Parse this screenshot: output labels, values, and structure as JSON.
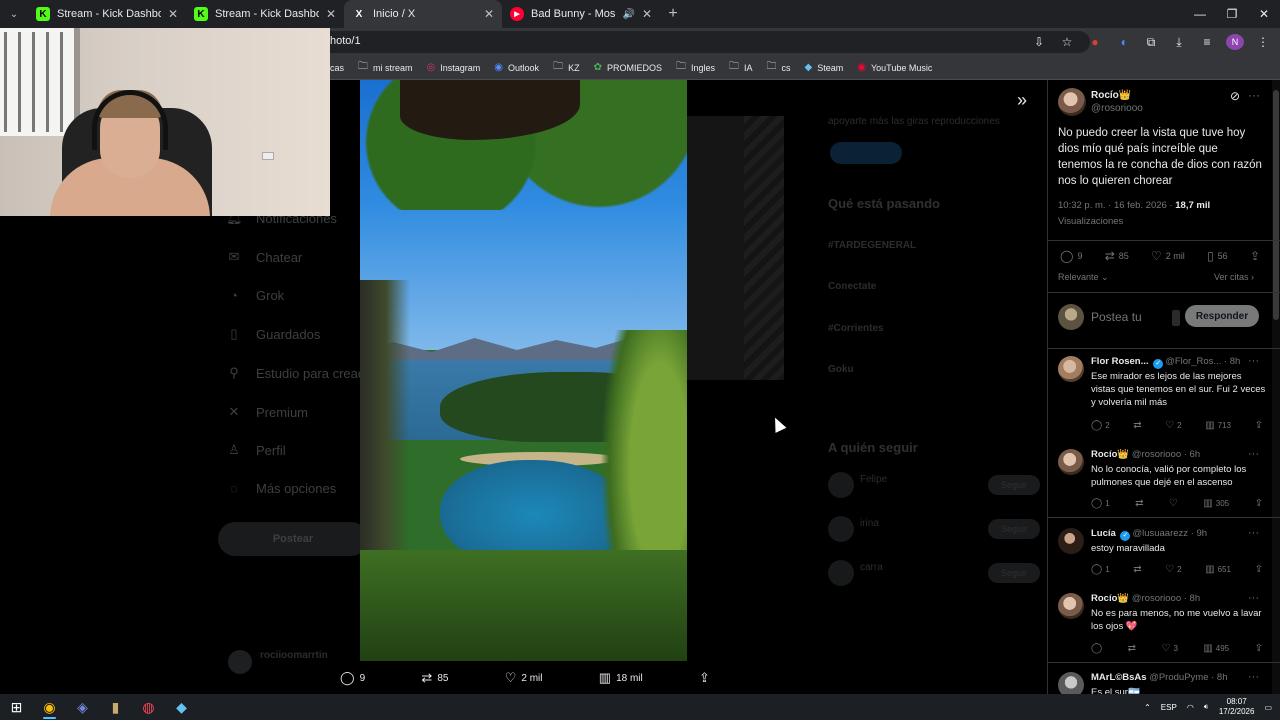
{
  "browser": {
    "tabs": [
      {
        "title": "Stream - Kick Dashboard",
        "favicon": "K",
        "color": "#53fc18"
      },
      {
        "title": "Stream - Kick Dashboard",
        "favicon": "K",
        "color": "#53fc18"
      },
      {
        "title": "Inicio / X",
        "favicon": "X",
        "color": "#ffffff"
      },
      {
        "title": "Bad Bunny - Moscow Mule",
        "favicon": "▶",
        "color": "#ff0033"
      }
    ],
    "url": "hoto/1",
    "bookmarks": [
      "cas",
      "mi stream",
      "Instagram",
      "Outlook",
      "KZ",
      "PROMIEDOS",
      "Ingles",
      "IA",
      "cs",
      "Steam",
      "YouTube Music"
    ],
    "profile_initial": "N"
  },
  "dimmed_nav": [
    "Notificaciones",
    "Chatear",
    "Grok",
    "Guardados",
    "Estudio para creadores",
    "Premium",
    "Perfil",
    "Más opciones"
  ],
  "dimmed_post_button": "Postear",
  "dimmed_user": "rociioomarrtin",
  "dimmed_right": {
    "premium_text": "apoyarte más las giras reproducciones",
    "trending_title": "Qué está pasando",
    "trends": [
      "#TARDEGENERAL",
      "Conectate",
      "#Corrientes",
      "Goku"
    ],
    "follow_title": "A quién seguir",
    "follow_names": [
      "Felipe",
      "irina",
      "carra"
    ],
    "follow_label": "Seguir"
  },
  "photo_bar": {
    "replies": "9",
    "reposts": "85",
    "likes": "2 mil",
    "views": "18 mil"
  },
  "post": {
    "author": "Rocío👑",
    "handle": "@rosoriooo",
    "text": "No puedo creer la vista que tuve hoy dios mío qué país increíble que tenemos la re concha de dios con razón nos lo quieren chorear",
    "time": "10:32 p. m. · 16 feb. 2026 · ",
    "views": "18,7 mil",
    "views_label": "Visualizaciones",
    "replies": "9",
    "reposts": "85",
    "likes": "2 mil",
    "bookmarks": "56",
    "sort_label": "Relevante",
    "see_quotes": "Ver citas",
    "reply_placeholder": "Postea tu",
    "reply_button": "Responder"
  },
  "replies": [
    {
      "name": "Flor Rosen...",
      "verified": true,
      "handle": "@Flor_Ros...",
      "time": "· 8h",
      "text": "Ese mirador es lejos de las mejores vistas que tenemos en el sur. Fui 2 veces y volvería mil más",
      "replies": "2",
      "reposts": "",
      "likes": "2",
      "views": "713"
    },
    {
      "name": "Rocío👑",
      "verified": false,
      "handle": "@rosoriooo",
      "time": "· 6h",
      "text": "No lo conocía, valió por completo los pulmones que dejé en el ascenso",
      "replies": "1",
      "reposts": "",
      "likes": "",
      "views": "305"
    },
    {
      "name": "Lucía",
      "verified": true,
      "handle": "@lusuaarezz",
      "time": "· 9h",
      "text": "estoy maravillada",
      "replies": "1",
      "reposts": "",
      "likes": "2",
      "views": "651"
    },
    {
      "name": "Rocío👑",
      "verified": false,
      "handle": "@rosoriooo",
      "time": "· 8h",
      "text": "No es para menos, no me vuelvo a lavar los ojos 💖",
      "replies": "",
      "reposts": "",
      "likes": "3",
      "views": "495"
    },
    {
      "name": "MArL©BsAs",
      "verified": false,
      "handle": "@ProduPyme",
      "time": "· 8h",
      "text": "Es el sur🇦🇷",
      "replies": "",
      "reposts": "",
      "likes": "",
      "views": ""
    }
  ],
  "taskbar": {
    "lang": "ESP",
    "time": "08:07",
    "date": "17/2/2026"
  }
}
